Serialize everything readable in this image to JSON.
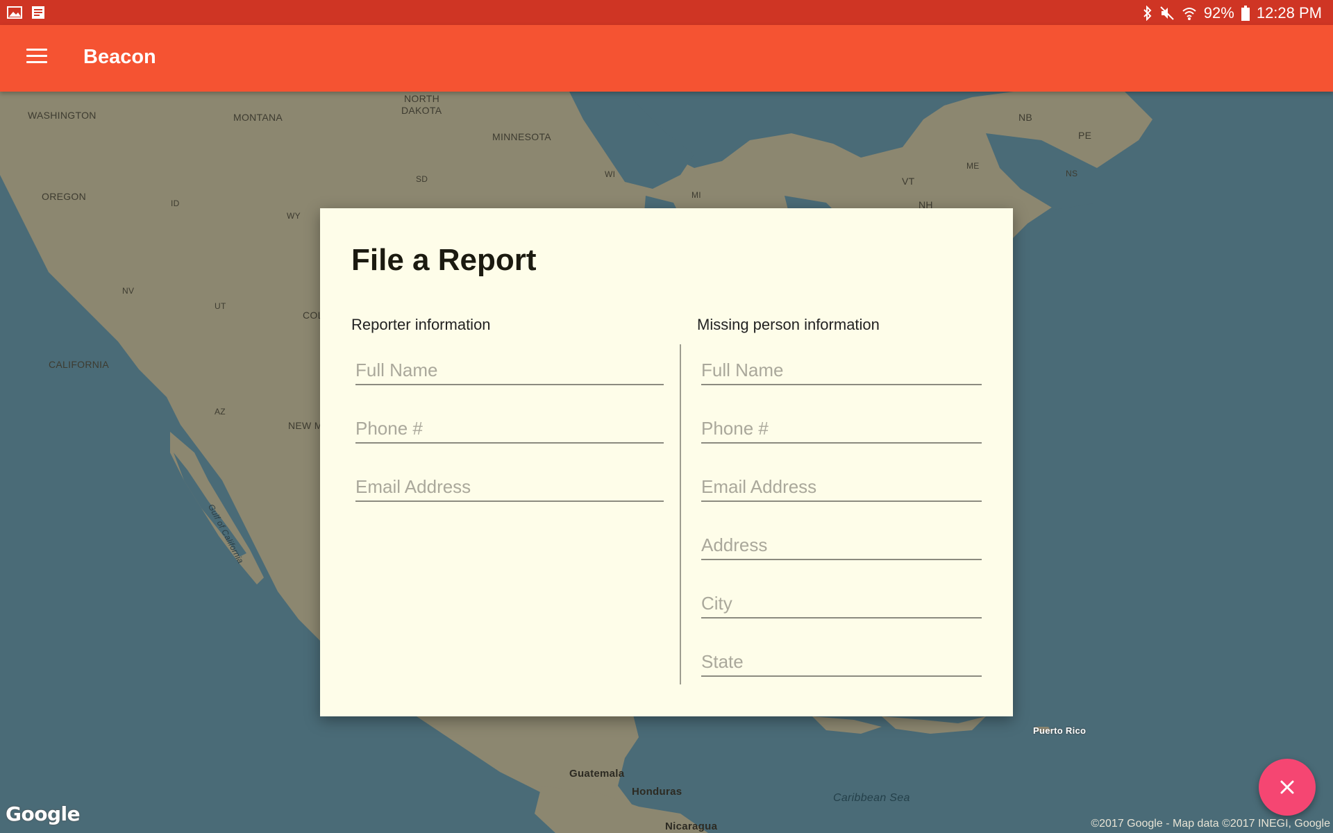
{
  "status_bar": {
    "left_icons": [
      "image-icon",
      "note-icon"
    ],
    "right_icons": [
      "bluetooth-icon",
      "mute-icon",
      "wifi-icon",
      "battery-icon"
    ],
    "battery": "92%",
    "time": "12:28 PM"
  },
  "app_bar": {
    "title": "Beacon",
    "menu_icon": "menu-icon",
    "color": "#f55332"
  },
  "map": {
    "labels": {
      "washington": "WASHINGTON",
      "montana": "MONTANA",
      "north_dakota_1": "NORTH",
      "north_dakota_2": "DAKOTA",
      "minnesota": "MINNESOTA",
      "oregon": "OREGON",
      "id": "ID",
      "wy": "WY",
      "sd": "SD",
      "wi": "WI",
      "mi": "MI",
      "nv": "NV",
      "ut": "UT",
      "col": "COL",
      "california": "CALIFORNIA",
      "az": "AZ",
      "new_m": "NEW M",
      "nb": "NB",
      "pe": "PE",
      "me": "ME",
      "ns": "NS",
      "vt": "VT",
      "nh": "NH",
      "puerto_rico": "Puerto Rico",
      "guatemala": "Guatemala",
      "honduras": "Honduras",
      "nicaragua": "Nicaragua",
      "caribbean_sea": "Caribbean Sea",
      "gulf_of_california": "Gulf of California"
    },
    "google_logo": "Google",
    "attribution": "©2017 Google - Map data ©2017 INEGI, Google"
  },
  "dialog": {
    "title": "File a Report",
    "reporter": {
      "label": "Reporter information",
      "fields": [
        {
          "placeholder": "Full Name",
          "value": ""
        },
        {
          "placeholder": "Phone #",
          "value": ""
        },
        {
          "placeholder": "Email Address",
          "value": ""
        }
      ]
    },
    "missing_person": {
      "label": "Missing person information",
      "fields": [
        {
          "placeholder": "Full Name",
          "value": ""
        },
        {
          "placeholder": "Phone #",
          "value": ""
        },
        {
          "placeholder": "Email Address",
          "value": ""
        },
        {
          "placeholder": "Address",
          "value": ""
        },
        {
          "placeholder": "City",
          "value": ""
        },
        {
          "placeholder": "State",
          "value": ""
        }
      ]
    }
  },
  "fab": {
    "icon": "close-icon",
    "color": "#f54672"
  }
}
